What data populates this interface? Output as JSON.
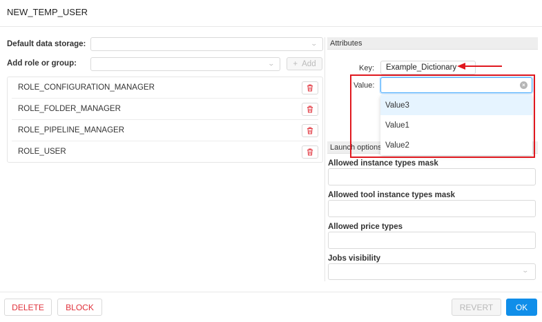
{
  "header": {
    "title": "NEW_TEMP_USER"
  },
  "form": {
    "default_storage_label": "Default data storage:",
    "default_storage_value": "",
    "add_role_label": "Add role or group:",
    "add_role_value": "",
    "add_button_label": "Add",
    "add_button_icon": "+"
  },
  "roles": [
    {
      "label": "ROLE_CONFIGURATION_MANAGER"
    },
    {
      "label": "ROLE_FOLDER_MANAGER"
    },
    {
      "label": "ROLE_PIPELINE_MANAGER"
    },
    {
      "label": "ROLE_USER"
    }
  ],
  "attributes": {
    "header": "Attributes",
    "key_label": "Key:",
    "key_value": "Example_Dictionary",
    "value_label": "Value:",
    "value_input": "",
    "options": [
      "Value3",
      "Value1",
      "Value2"
    ],
    "active_option": "Value3"
  },
  "launch_options": {
    "header": "Launch options",
    "allowed_instance_types_label": "Allowed instance types mask",
    "allowed_tool_instance_types_label": "Allowed tool instance types mask",
    "allowed_price_types_label": "Allowed price types",
    "jobs_visibility_label": "Jobs visibility"
  },
  "footer": {
    "delete_label": "DELETE",
    "block_label": "BLOCK",
    "revert_label": "REVERT",
    "ok_label": "OK"
  },
  "colors": {
    "danger": "#e0303a",
    "primary": "#108ee9",
    "highlight": "#e0171e",
    "active_option_bg": "#e6f4ff"
  }
}
